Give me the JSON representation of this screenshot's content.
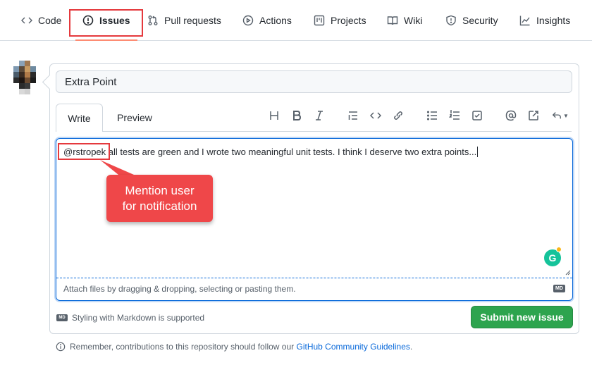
{
  "nav": {
    "tabs": [
      {
        "label": "Code",
        "icon": "code-icon"
      },
      {
        "label": "Issues",
        "icon": "issue-opened-icon",
        "active": true
      },
      {
        "label": "Pull requests",
        "icon": "git-pull-request-icon"
      },
      {
        "label": "Actions",
        "icon": "play-icon"
      },
      {
        "label": "Projects",
        "icon": "project-icon"
      },
      {
        "label": "Wiki",
        "icon": "book-icon"
      },
      {
        "label": "Security",
        "icon": "shield-icon"
      },
      {
        "label": "Insights",
        "icon": "graph-icon"
      }
    ]
  },
  "issue": {
    "title_value": "Extra Point",
    "editor_tabs": {
      "write": "Write",
      "preview": "Preview"
    },
    "toolbar": [
      "heading-icon",
      "bold-icon",
      "italic-icon",
      "quote-icon",
      "code-icon",
      "link-icon",
      "unordered-list-icon",
      "ordered-list-icon",
      "tasklist-icon",
      "mention-icon",
      "cross-reference-icon",
      "reply-icon"
    ],
    "body_mention": "@rstropek",
    "body_text": " all tests are green and I wrote two meaningful unit tests. I think I deserve two extra points...",
    "attach_hint": "Attach files by dragging & dropping, selecting or pasting them.",
    "markdown_note": "Styling with Markdown is supported",
    "markdown_badge": "MD",
    "submit_label": "Submit new issue"
  },
  "footer": {
    "prefix": "Remember, contributions to this repository should follow our ",
    "link": "GitHub Community Guidelines",
    "suffix": "."
  },
  "callout": {
    "line1": "Mention user",
    "line2": "for notification"
  },
  "grammarly": {
    "letter": "G"
  },
  "colors": {
    "accent": "#0969da",
    "primary_button": "#2da44e",
    "annotation_red": "#e5393d",
    "active_tab_underline": "#fd8c73"
  }
}
